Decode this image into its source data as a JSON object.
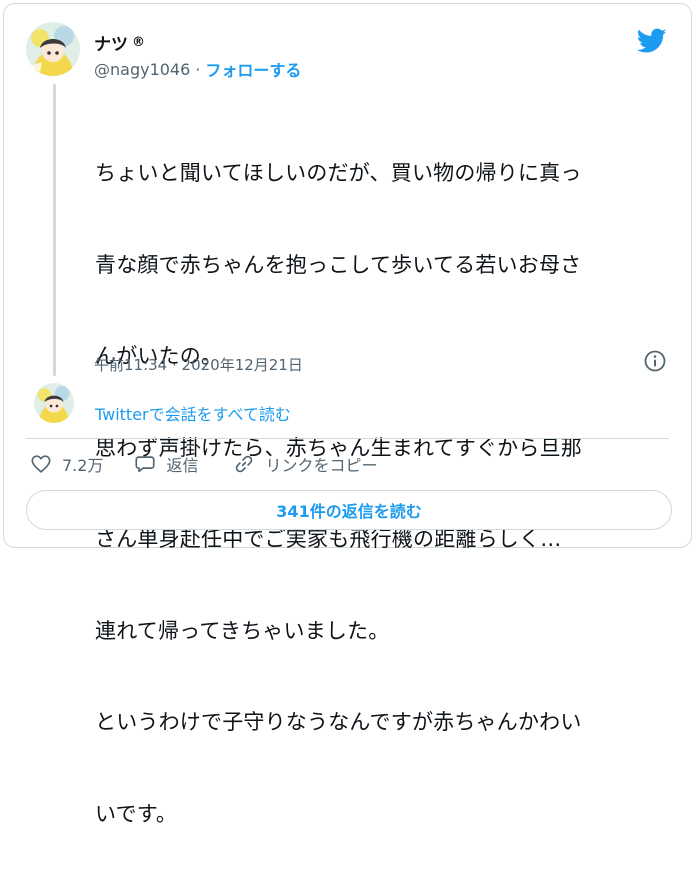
{
  "author": {
    "name": "ナツ",
    "badge": "®",
    "handle": "@nagy1046",
    "separator": "·",
    "follow_label": "フォローする"
  },
  "tweet": {
    "lines": [
      "ちょいと聞いてほしいのだが、買い物の帰りに真っ",
      "青な顔で赤ちゃんを抱っこして歩いてる若いお母さ",
      "んがいたの。",
      "思わず声掛けたら、赤ちゃん生まれてすぐから旦那",
      "さん単身赴任中でご実家も飛行機の距離らしく…",
      "連れて帰ってきちゃいました。",
      "というわけで子守りなうなんですが赤ちゃんかわい",
      "いです。"
    ],
    "timestamp": "午前11:34 · 2020年12月21日"
  },
  "thread": {
    "read_conversation_label": "Twitterで会話をすべて読む"
  },
  "actions": {
    "like_count": "7.2万",
    "reply_label": "返信",
    "copy_link_label": "リンクをコピー"
  },
  "replies_button_label": "341件の返信を読む",
  "icons": {
    "brand": "twitter-bird-icon",
    "info": "info-icon",
    "like": "heart-icon",
    "reply": "speech-bubble-icon",
    "link": "link-icon"
  },
  "colors": {
    "accent": "#1d9bf0",
    "text": "#0f1419",
    "secondary": "#536471",
    "border": "#cfd9de"
  }
}
